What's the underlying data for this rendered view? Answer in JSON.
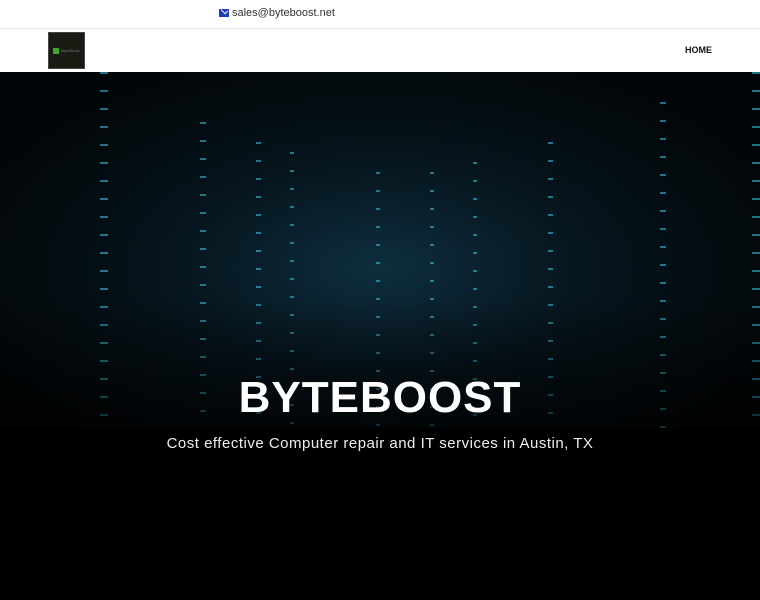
{
  "topbar": {
    "email": "sales@byteboost.net",
    "email_icon": "envelope-icon"
  },
  "nav": {
    "logo_text": "ByteBoost",
    "home": "HOME"
  },
  "hero": {
    "title": "BYTEBOOST",
    "subtitle": "Cost effective Computer repair and IT services in Austin, TX"
  },
  "colors": {
    "accent": "#1e3fb8",
    "glow": "#3cc8e6"
  }
}
